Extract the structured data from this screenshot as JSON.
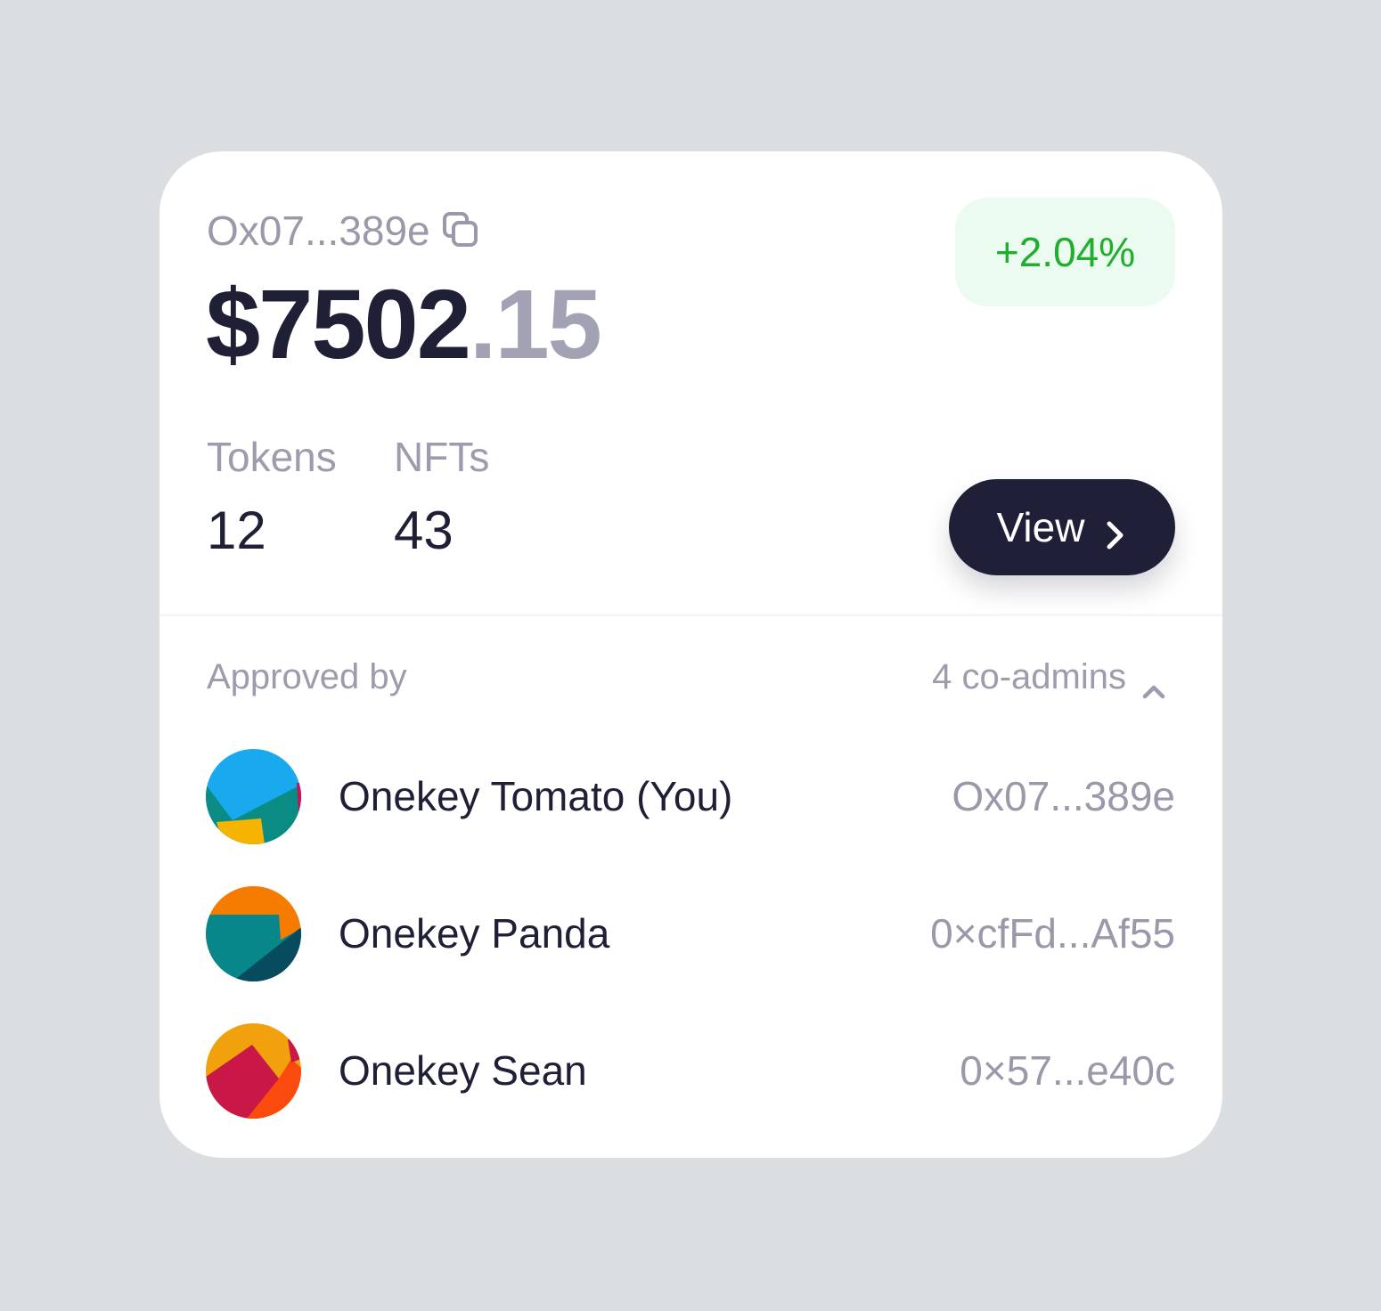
{
  "wallet": {
    "address": "Ox07...389e",
    "balance_whole": "$7502",
    "balance_cents": ".15",
    "change": "+2.04%",
    "change_color": "#1fae2d"
  },
  "stats": {
    "tokens_label": "Tokens",
    "tokens_value": "12",
    "nfts_label": "NFTs",
    "nfts_value": "43"
  },
  "actions": {
    "view_label": "View",
    "view_icon": "chevron-right-icon",
    "copy_icon": "copy-icon"
  },
  "approvals": {
    "label": "Approved by",
    "coadmins_label": "4 co-admins",
    "coadmins_icon": "chevron-up-icon",
    "admins": [
      {
        "name": "Onekey Tomato (You)",
        "address": "Ox07...389e"
      },
      {
        "name": "Onekey Panda",
        "address": "0×cfFd...Af55"
      },
      {
        "name": "Onekey Sean",
        "address": "0×57...e40c"
      }
    ]
  },
  "colors": {
    "background": "#dadee1",
    "card": "#ffffff",
    "primary_text": "#1f1f36",
    "muted_text": "#9c9cac",
    "button": "#1f2038",
    "badge_bg": "#ebfbef"
  }
}
